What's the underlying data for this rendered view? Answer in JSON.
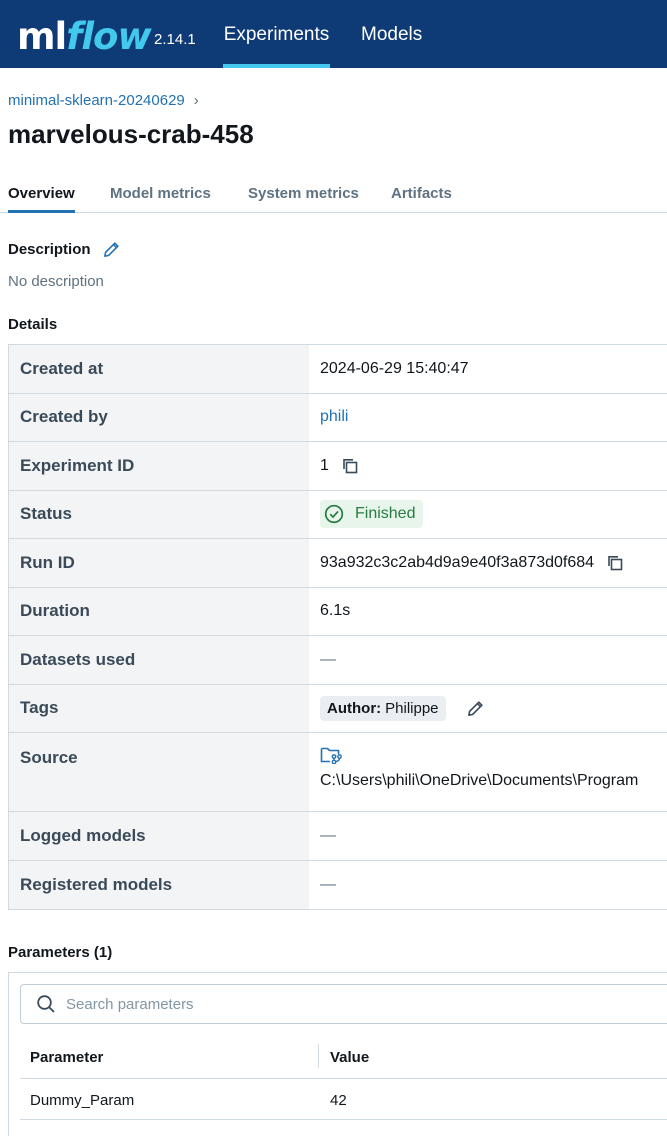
{
  "brand": {
    "logo_ml": "ml",
    "logo_flow": "flow",
    "version": "2.14.1"
  },
  "nav": {
    "experiments": "Experiments",
    "models": "Models"
  },
  "breadcrumb": {
    "experiment": "minimal-sklearn-20240629",
    "chevron": "›"
  },
  "run": {
    "title": "marvelous-crab-458"
  },
  "tabs": {
    "overview": "Overview",
    "model_metrics": "Model metrics",
    "system_metrics": "System metrics",
    "artifacts": "Artifacts"
  },
  "description": {
    "label": "Description",
    "value": "No description"
  },
  "details": {
    "label": "Details",
    "created_at": {
      "key": "Created at",
      "value": "2024-06-29 15:40:47"
    },
    "created_by": {
      "key": "Created by",
      "value": "phili"
    },
    "experiment_id": {
      "key": "Experiment ID",
      "value": "1"
    },
    "status": {
      "key": "Status",
      "value": "Finished"
    },
    "run_id": {
      "key": "Run ID",
      "value": "93a932c3c2ab4d9a9e40f3a873d0f684"
    },
    "duration": {
      "key": "Duration",
      "value": "6.1s"
    },
    "datasets_used": {
      "key": "Datasets used",
      "value": "—"
    },
    "tags": {
      "key": "Tags",
      "tag_key": "Author:",
      "tag_value": "Philippe"
    },
    "source": {
      "key": "Source",
      "value": "C:\\Users\\phili\\OneDrive\\Documents\\Program"
    },
    "logged_models": {
      "key": "Logged models",
      "value": "—"
    },
    "registered_models": {
      "key": "Registered models",
      "value": "—"
    }
  },
  "parameters": {
    "label": "Parameters (1)",
    "search_placeholder": "Search parameters",
    "col_param": "Parameter",
    "col_value": "Value",
    "rows": [
      {
        "name": "Dummy_Param",
        "value": "42"
      }
    ]
  },
  "colors": {
    "nav_bg": "#0e3a75",
    "accent": "#43c9ed",
    "link": "#2272b4",
    "success": "#277c43"
  },
  "icons": [
    "pencil-icon",
    "copy-icon",
    "check-circle-icon",
    "folder-branch-icon",
    "search-icon"
  ]
}
